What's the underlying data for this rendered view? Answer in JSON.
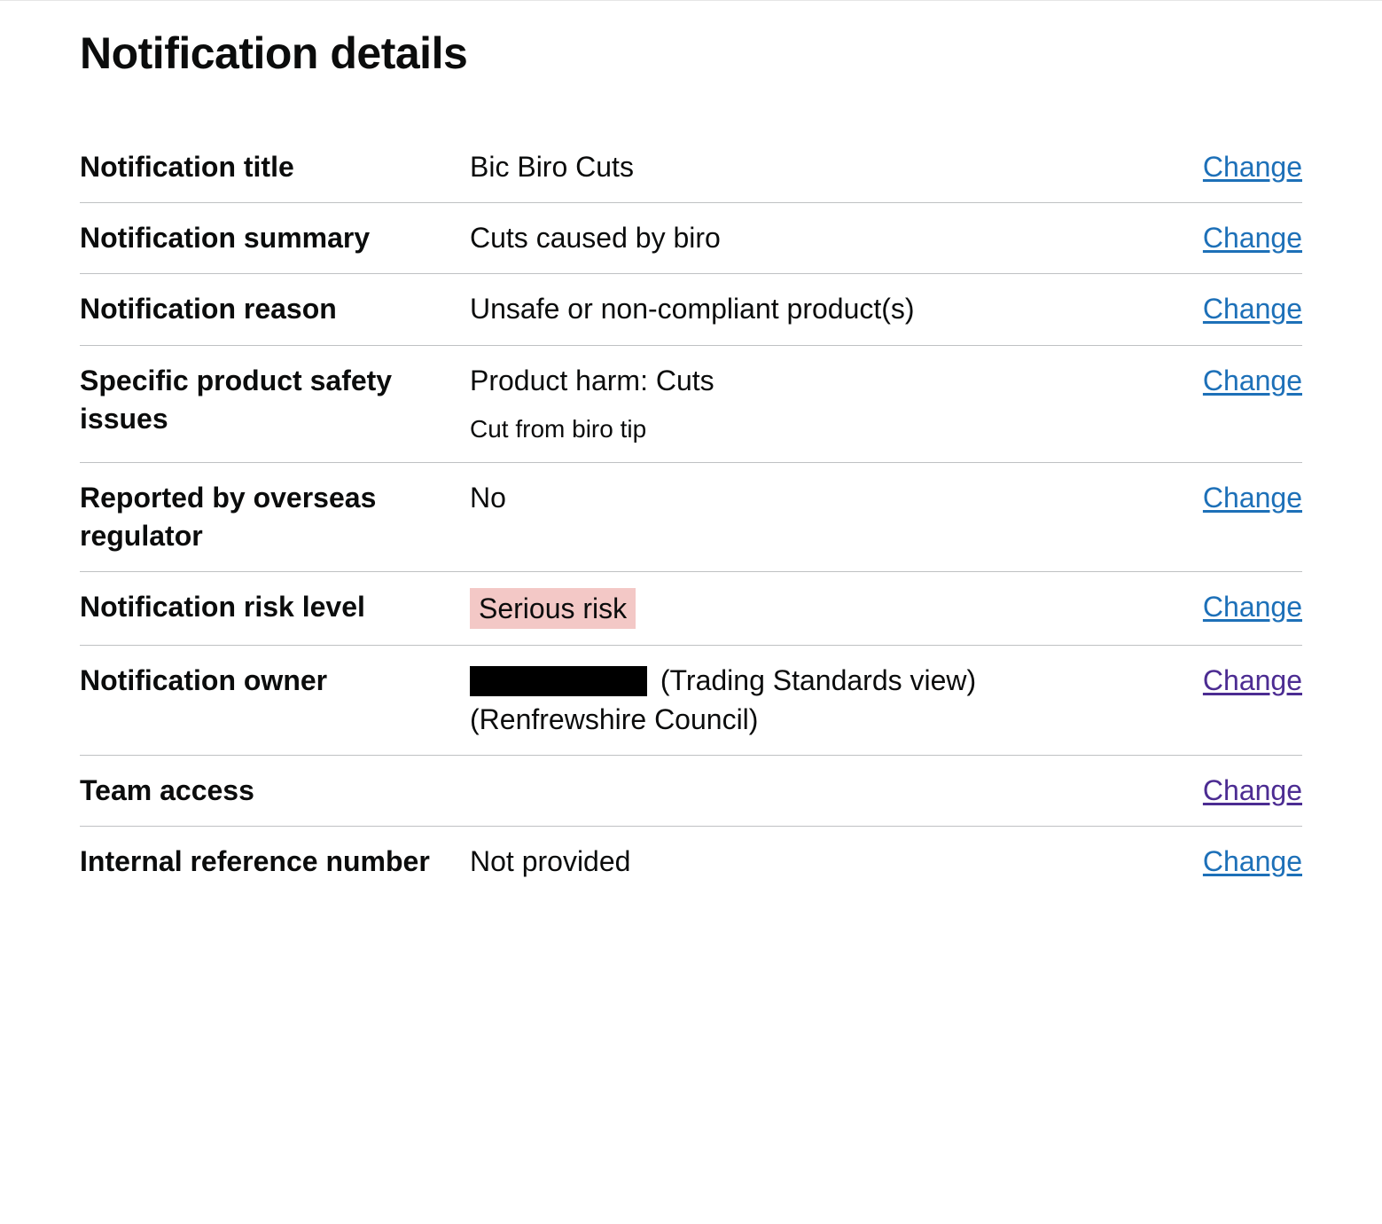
{
  "heading": "Notification details",
  "change_label": "Change",
  "rows": {
    "title": {
      "key": "Notification title",
      "value": "Bic Biro Cuts"
    },
    "summary": {
      "key": "Notification summary",
      "value": "Cuts caused by biro"
    },
    "reason": {
      "key": "Notification reason",
      "value": "Unsafe or non-compliant product(s)"
    },
    "issues": {
      "key": "Specific product safety issues",
      "value": "Product harm: Cuts",
      "sub": "Cut from biro tip"
    },
    "overseas": {
      "key": "Reported by overseas regulator",
      "value": "No"
    },
    "risk": {
      "key": "Notification risk level",
      "value": "Serious risk"
    },
    "owner": {
      "key": "Notification owner",
      "suffix1": "(Trading Standards view)",
      "suffix2": "(Renfrewshire Council)"
    },
    "team_access": {
      "key": "Team access",
      "value": ""
    },
    "internal_ref": {
      "key": "Internal reference number",
      "value": "Not provided"
    }
  }
}
